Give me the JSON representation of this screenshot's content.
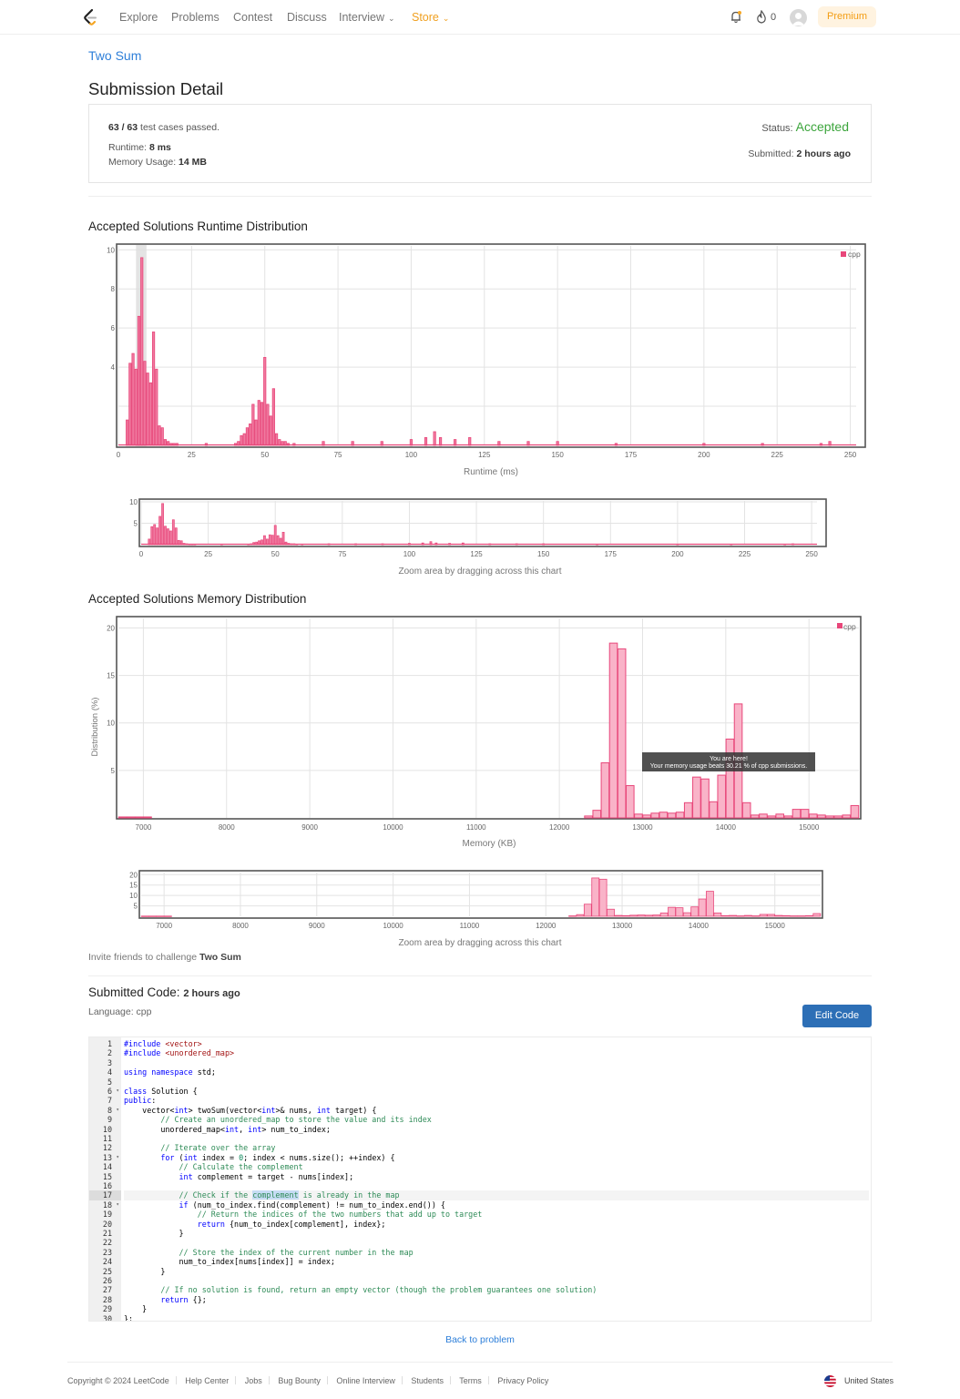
{
  "nav": {
    "items": [
      "Explore",
      "Problems",
      "Contest",
      "Discuss",
      "Interview",
      "Store"
    ],
    "streak": "0",
    "premium": "Premium"
  },
  "problem": {
    "name": "Two Sum"
  },
  "page_title": "Submission Detail",
  "result": {
    "cases": "63 / 63",
    "cases_suffix": "test cases passed.",
    "runtime_label": "Runtime:",
    "runtime": "8 ms",
    "memory_label": "Memory Usage:",
    "memory": "14 MB",
    "status_label": "Status:",
    "status": "Accepted",
    "submitted_label": "Submitted:",
    "submitted": "2 hours ago",
    "status_color": "#3ca53c"
  },
  "chart_data": [
    {
      "type": "bar",
      "title": "Accepted Solutions Runtime Distribution",
      "xlabel": "Runtime (ms)",
      "ylabel": "",
      "xlim": [
        0,
        252
      ],
      "ylim": [
        0,
        10.2
      ],
      "xticks": [
        0,
        25,
        50,
        75,
        100,
        125,
        150,
        175,
        200,
        225,
        250
      ],
      "yticks": [
        4,
        6,
        8,
        10
      ],
      "legend": "cpp",
      "legend_position": "top-right",
      "highlight_x": 8,
      "zoom_hint": "Zoom area by dragging across this chart",
      "color": "#e8477a",
      "x": [
        3,
        4,
        5,
        6,
        7,
        8,
        9,
        10,
        11,
        12,
        13,
        14,
        15,
        16,
        17,
        18,
        19,
        20,
        30,
        40,
        41,
        42,
        43,
        44,
        45,
        46,
        47,
        48,
        49,
        50,
        51,
        52,
        53,
        54,
        55,
        56,
        57,
        58,
        60,
        70,
        80,
        90,
        100,
        105,
        108,
        110,
        115,
        120,
        130,
        140,
        150,
        170,
        200,
        220,
        240,
        243
      ],
      "values": [
        1.3,
        4.2,
        4.7,
        3.9,
        6.6,
        9.6,
        4.3,
        3.7,
        3.2,
        5.8,
        3.9,
        1.0,
        0.9,
        0.3,
        0.2,
        0.1,
        0.1,
        0.1,
        0.1,
        0.1,
        0.2,
        0.5,
        0.6,
        0.9,
        1.1,
        2.1,
        1.3,
        2.3,
        2.2,
        4.5,
        2.1,
        1.5,
        2.9,
        0.6,
        0.3,
        0.2,
        0.2,
        0.1,
        0.1,
        0.2,
        0.2,
        0.2,
        0.3,
        0.4,
        0.7,
        0.4,
        0.3,
        0.4,
        0.2,
        0.2,
        0.2,
        0.1,
        0.1,
        0.1,
        0.1,
        0.2
      ]
    },
    {
      "type": "bar",
      "title": "Accepted Solutions Memory Distribution",
      "xlabel": "Memory (KB)",
      "ylabel": "Distribution (%)",
      "xlim": [
        6700,
        15600
      ],
      "ylim": [
        0,
        21
      ],
      "xticks": [
        7000,
        8000,
        9000,
        10000,
        11000,
        12000,
        13000,
        14000,
        15000
      ],
      "yticks": [
        5,
        10,
        15,
        20
      ],
      "legend": "cpp",
      "legend_position": "top-right",
      "zoom_hint": "Zoom area by dragging across this chart",
      "tooltip": [
        "You are here!",
        "Your memory usage beats 30.21 % of cpp submissions."
      ],
      "color": "#e8477a",
      "x": [
        6750,
        6850,
        6950,
        7050,
        12350,
        12450,
        12550,
        12650,
        12750,
        12850,
        12950,
        13050,
        13150,
        13250,
        13350,
        13450,
        13550,
        13650,
        13750,
        13850,
        13950,
        14050,
        14150,
        14250,
        14350,
        14450,
        14550,
        14650,
        14750,
        14850,
        14950,
        15050,
        15150,
        15250,
        15350,
        15450,
        15550
      ],
      "values": [
        0.1,
        0.1,
        0.1,
        0.1,
        0.2,
        0.8,
        5.8,
        18.4,
        17.8,
        3.4,
        0.4,
        0.3,
        0.5,
        0.6,
        0.5,
        0.6,
        1.6,
        4.3,
        4.1,
        1.7,
        4.5,
        8.3,
        12.0,
        1.6,
        0.3,
        0.4,
        0.2,
        0.4,
        0.2,
        0.9,
        0.9,
        0.4,
        0.3,
        0.2,
        0.2,
        0.3,
        1.3
      ]
    }
  ],
  "invite": {
    "prefix": "Invite friends to challenge",
    "name": "Two Sum"
  },
  "code_section": {
    "title": "Submitted Code:",
    "time": "2 hours ago",
    "language": "Language: cpp",
    "edit": "Edit Code"
  },
  "code": [
    "#include <vector>",
    "#include <unordered_map>",
    "",
    "using namespace std;",
    "",
    "class Solution {",
    "public:",
    "    vector<int> twoSum(vector<int>& nums, int target) {",
    "        // Create an unordered_map to store the value and its index",
    "        unordered_map<int, int> num_to_index;",
    "",
    "        // Iterate over the array",
    "        for (int index = 0; index < nums.size(); ++index) {",
    "            // Calculate the complement",
    "            int complement = target - nums[index];",
    "",
    "            // Check if the complement is already in the map",
    "            if (num_to_index.find(complement) != num_to_index.end()) {",
    "                // Return the indices of the two numbers that add up to target",
    "                return {num_to_index[complement], index};",
    "            }",
    "",
    "            // Store the index of the current number in the map",
    "            num_to_index[nums[index]] = index;",
    "        }",
    "",
    "        // If no solution is found, return an empty vector (though the problem guarantees one solution)",
    "        return {};",
    "    }",
    "};"
  ],
  "back_link": "Back to problem",
  "footer": {
    "copyright": "Copyright © 2024 LeetCode",
    "links": [
      "Help Center",
      "Jobs",
      "Bug Bounty",
      "Online Interview",
      "Students",
      "Terms",
      "Privacy Policy"
    ],
    "country": "United States"
  }
}
